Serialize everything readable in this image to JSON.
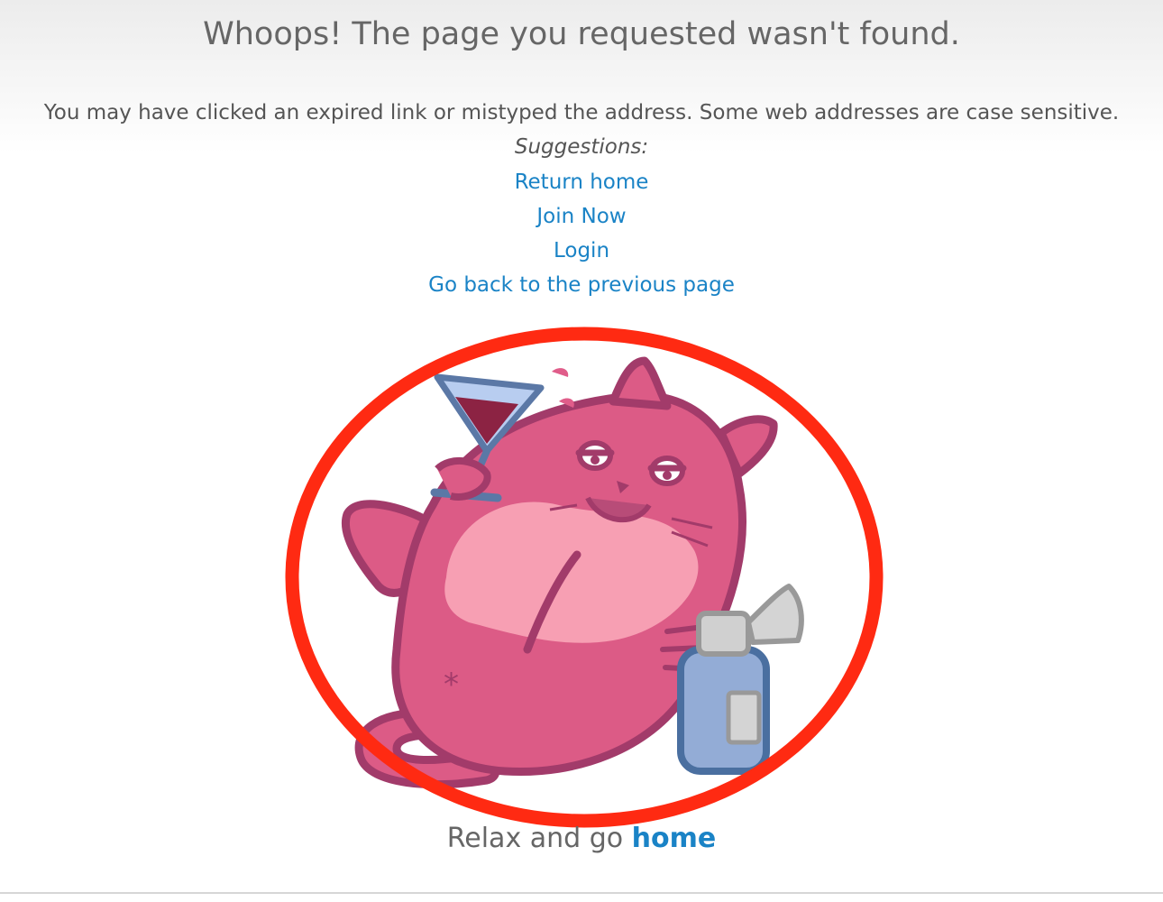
{
  "page": {
    "title": "Whoops! The page you requested wasn't found.",
    "message": "You may have clicked an expired link or mistyped the address. Some web addresses are case sensitive.",
    "suggestions_heading": "Suggestions:",
    "suggestions": [
      {
        "label": "Return home"
      },
      {
        "label": "Join Now"
      },
      {
        "label": "Login"
      },
      {
        "label": "Go back to the previous page"
      }
    ]
  },
  "illustration": {
    "subject": "pink-cat-with-cocktail-and-bottle",
    "highlight_color": "#ff2a12"
  },
  "footer": {
    "prefix": "Relax and go ",
    "link_label": "home"
  },
  "colors": {
    "link": "#1a83c6",
    "text": "#555555",
    "cat_body": "#dc5b86",
    "cat_outline": "#a23b6a",
    "cat_belly": "#f79fb3",
    "bottle": "#93acd6"
  }
}
